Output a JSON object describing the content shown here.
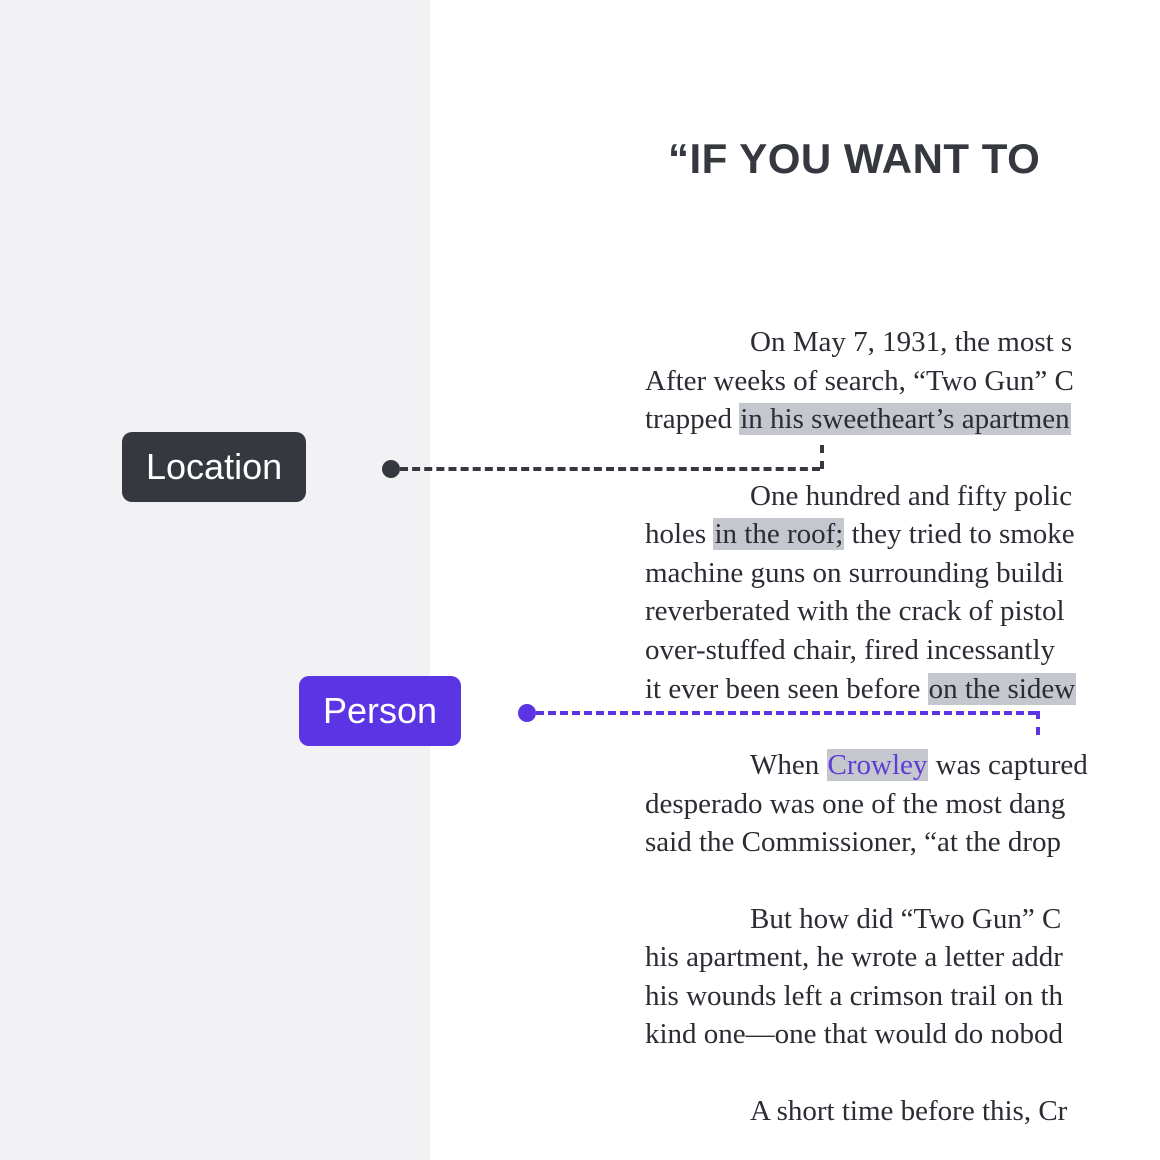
{
  "tags": {
    "location": "Location",
    "person": "Person"
  },
  "colors": {
    "location_bg": "#35383f",
    "person_bg": "#5b35e3",
    "highlight_bg": "#c5c7ce"
  },
  "document": {
    "title": "“IF YOU WANT TO",
    "paragraphs": {
      "p1_pre": "On May 7, 1931, the most s",
      "p1_line2a": "After weeks of search, “Two Gun” C",
      "p1_line3a": "trapped ",
      "p1_hl1": "in his sweetheart’s apartmen",
      "p2_pre": "One hundred and fifty polic",
      "p2_line2a": "holes ",
      "p2_hl1": "in the roof;",
      "p2_line2b": " they tried to smoke",
      "p2_line3": "machine guns on surrounding buildi",
      "p2_line4": "reverberated with the crack of pistol",
      "p2_line5": "over-stuffed chair, fired incessantly ",
      "p2_line6a": "it ever been seen before ",
      "p2_hl2": "on the sidew",
      "p3_pre": "When ",
      "p3_hl_person": "Crowley",
      "p3_post": " was captured",
      "p3_line2": "desperado was one of the most dang",
      "p3_line3": "said the Commissioner, “at the drop",
      "p4_line1": "But how did “Two Gun” C",
      "p4_line2": "his apartment, he wrote a letter addr",
      "p4_line3": "his wounds left a crimson trail on th",
      "p4_line4": "kind one—one that would do nobod",
      "p5_line1": "A short time before this, Cr"
    }
  }
}
